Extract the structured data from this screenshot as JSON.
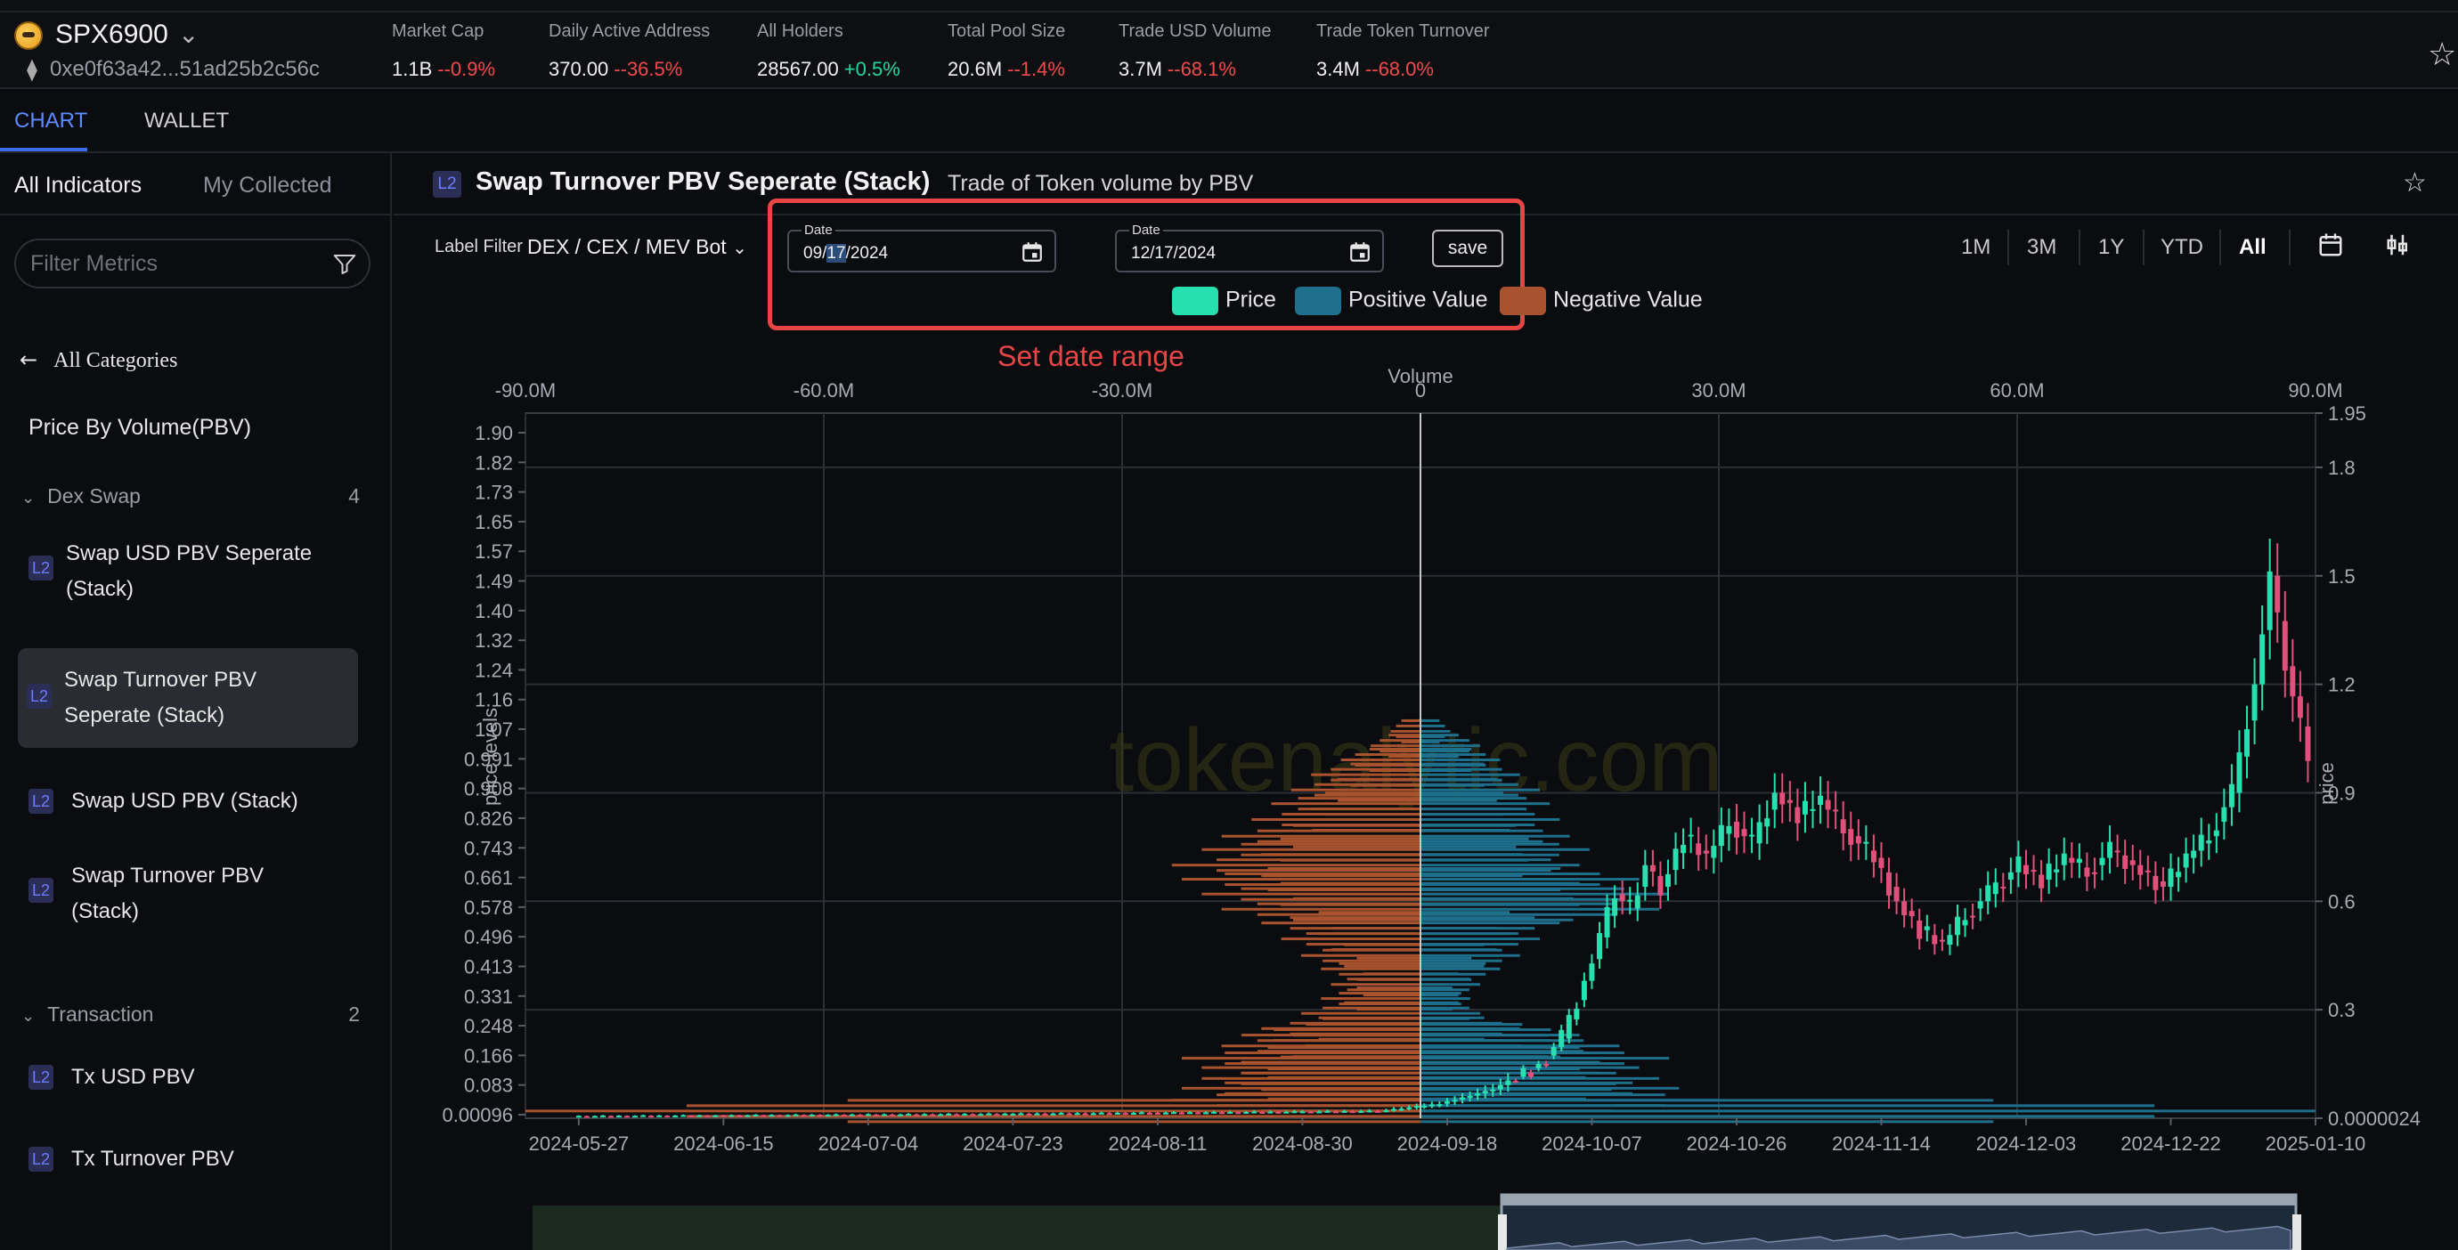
{
  "token": {
    "name": "SPX6900",
    "address": "0xe0f63a42...51ad25b2c56c"
  },
  "metrics": [
    {
      "label": "Market Cap",
      "value": "1.1B",
      "change": "--0.9%",
      "dir": "neg"
    },
    {
      "label": "Daily Active Address",
      "value": "370.00",
      "change": "--36.5%",
      "dir": "neg"
    },
    {
      "label": "All Holders",
      "value": "28567.00",
      "change": "+0.5%",
      "dir": "pos"
    },
    {
      "label": "Total Pool Size",
      "value": "20.6M",
      "change": "--1.4%",
      "dir": "neg"
    },
    {
      "label": "Trade USD Volume",
      "value": "3.7M",
      "change": "--68.1%",
      "dir": "neg"
    },
    {
      "label": "Trade Token Turnover",
      "value": "3.4M",
      "change": "--68.0%",
      "dir": "neg"
    }
  ],
  "nav": {
    "chart": "CHART",
    "wallet": "WALLET"
  },
  "sidebar": {
    "tab_all": "All Indicators",
    "tab_collected": "My Collected",
    "filter_placeholder": "Filter Metrics",
    "back_label": "All Categories",
    "section_title": "Price By Volume(PBV)",
    "groups": [
      {
        "name": "Dex Swap",
        "count": "4"
      },
      {
        "name": "Transaction",
        "count": "2"
      }
    ],
    "items": [
      {
        "badge": "L2",
        "label": "Swap USD PBV Seperate (Stack)"
      },
      {
        "badge": "L2",
        "label": "Swap Turnover PBV Seperate (Stack)"
      },
      {
        "badge": "L2",
        "label": "Swap USD PBV (Stack)"
      },
      {
        "badge": "L2",
        "label": "Swap Turnover PBV (Stack)"
      },
      {
        "badge": "L2",
        "label": "Tx USD PBV"
      },
      {
        "badge": "L2",
        "label": "Tx Turnover PBV"
      }
    ]
  },
  "main": {
    "badge": "L2",
    "title": "Swap Turnover PBV Seperate (Stack)",
    "subtitle": "Trade of Token volume by PBV"
  },
  "toolbar": {
    "label_filter": "Label Filter",
    "label_filter_value": "DEX / CEX / MEV Bot",
    "date_label": "Date",
    "start_date_pre": "09/",
    "start_date_hl": "17",
    "start_date_post": "/2024",
    "end_date": "12/17/2024",
    "save": "save",
    "annotation": "Set date range",
    "ranges": [
      "1M",
      "3M",
      "1Y",
      "YTD",
      "All"
    ],
    "active_range": "All"
  },
  "colors": {
    "price": "#27e0b0",
    "positive": "#1e6f8c",
    "negative": "#a8532e",
    "accent": "#3a6cf0",
    "annotation": "#e84545"
  },
  "chart_data": {
    "type": "pbv-candlestick",
    "legend": [
      "Price",
      "Positive Value",
      "Negative Value"
    ],
    "watermark": "tokenalytic.com",
    "top_axis": {
      "label": "Volume",
      "ticks": [
        "-90.0M",
        "-60.0M",
        "-30.0M",
        "0",
        "30.0M",
        "60.0M",
        "90.0M"
      ],
      "range": [
        -90000000,
        90000000
      ]
    },
    "left_axis": {
      "label": "price levels",
      "ticks": [
        "1.90",
        "1.82",
        "1.73",
        "1.65",
        "1.57",
        "1.49",
        "1.40",
        "1.32",
        "1.24",
        "1.16",
        "1.07",
        "0.991",
        "0.908",
        "0.826",
        "0.743",
        "0.661",
        "0.578",
        "0.496",
        "0.413",
        "0.331",
        "0.248",
        "0.166",
        "0.083",
        "0.00096"
      ]
    },
    "right_axis": {
      "label": "price",
      "ticks": [
        "1.95",
        "1.8",
        "1.5",
        "1.2",
        "0.9",
        "0.6",
        "0.3",
        "0.0000024"
      ],
      "range": [
        2.4e-06,
        1.95
      ]
    },
    "x_axis": {
      "ticks": [
        "2024-05-27",
        "2024-06-15",
        "2024-07-04",
        "2024-07-23",
        "2024-08-11",
        "2024-08-30",
        "2024-09-18",
        "2024-10-07",
        "2024-10-26",
        "2024-11-14",
        "2024-12-03",
        "2024-12-22",
        "2025-01-10"
      ],
      "range": [
        "2024-05-20",
        "2025-01-10"
      ]
    },
    "pbv": {
      "prices": [
        0.02,
        0.05,
        0.083,
        0.11,
        0.14,
        0.166,
        0.2,
        0.23,
        0.248,
        0.29,
        0.331,
        0.37,
        0.413,
        0.45,
        0.496,
        0.54,
        0.578,
        0.62,
        0.661,
        0.7,
        0.743,
        0.78,
        0.826,
        0.87,
        0.908,
        0.95,
        0.991,
        1.03,
        1.07
      ],
      "positive": [
        90000000,
        30000000,
        26000000,
        24000000,
        22000000,
        25000000,
        20000000,
        16000000,
        10000000,
        6000000,
        5000000,
        6000000,
        8000000,
        10000000,
        12000000,
        14000000,
        24000000,
        25000000,
        22000000,
        16000000,
        17000000,
        15000000,
        14000000,
        13000000,
        12000000,
        10000000,
        8000000,
        6000000,
        3000000
      ],
      "negative": [
        -95000000,
        -25000000,
        -24000000,
        -22000000,
        -22000000,
        -24000000,
        -20000000,
        -18000000,
        -16000000,
        -12000000,
        -10000000,
        -9000000,
        -10000000,
        -12000000,
        -14000000,
        -16000000,
        -20000000,
        -22000000,
        -24000000,
        -25000000,
        -22000000,
        -20000000,
        -17000000,
        -15000000,
        -13000000,
        -11000000,
        -8000000,
        -5000000,
        -3000000
      ]
    },
    "price_series": [
      [
        "2024-05-27",
        0.006
      ],
      [
        "2024-06-15",
        0.008
      ],
      [
        "2024-07-04",
        0.01
      ],
      [
        "2024-07-23",
        0.012
      ],
      [
        "2024-08-11",
        0.015
      ],
      [
        "2024-08-30",
        0.018
      ],
      [
        "2024-09-10",
        0.02
      ],
      [
        "2024-09-18",
        0.04
      ],
      [
        "2024-09-25",
        0.08
      ],
      [
        "2024-10-01",
        0.15
      ],
      [
        "2024-10-04",
        0.22
      ],
      [
        "2024-10-07",
        0.38
      ],
      [
        "2024-10-09",
        0.5
      ],
      [
        "2024-10-11",
        0.62
      ],
      [
        "2024-10-13",
        0.58
      ],
      [
        "2024-10-15",
        0.7
      ],
      [
        "2024-10-17",
        0.64
      ],
      [
        "2024-10-20",
        0.78
      ],
      [
        "2024-10-23",
        0.72
      ],
      [
        "2024-10-26",
        0.82
      ],
      [
        "2024-10-29",
        0.76
      ],
      [
        "2024-11-01",
        0.9
      ],
      [
        "2024-11-04",
        0.84
      ],
      [
        "2024-11-07",
        0.88
      ],
      [
        "2024-11-10",
        0.8
      ],
      [
        "2024-11-14",
        0.72
      ],
      [
        "2024-11-17",
        0.6
      ],
      [
        "2024-11-20",
        0.52
      ],
      [
        "2024-11-23",
        0.48
      ],
      [
        "2024-11-26",
        0.56
      ],
      [
        "2024-11-29",
        0.62
      ],
      [
        "2024-12-03",
        0.7
      ],
      [
        "2024-12-06",
        0.66
      ],
      [
        "2024-12-09",
        0.72
      ],
      [
        "2024-12-12",
        0.68
      ],
      [
        "2024-12-15",
        0.74
      ],
      [
        "2024-12-18",
        0.7
      ],
      [
        "2024-12-22",
        0.64
      ],
      [
        "2024-12-25",
        0.72
      ],
      [
        "2024-12-28",
        0.78
      ],
      [
        "2024-12-31",
        0.9
      ],
      [
        "2025-01-03",
        1.2
      ],
      [
        "2025-01-05",
        1.5
      ],
      [
        "2025-01-07",
        1.25
      ],
      [
        "2025-01-10",
        1.0
      ]
    ]
  }
}
